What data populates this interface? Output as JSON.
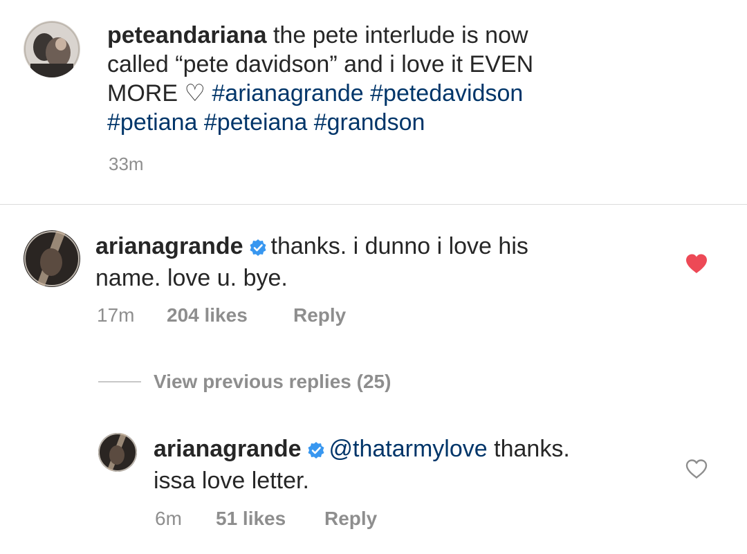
{
  "caption": {
    "username": "peteandariana",
    "text_line1": "the pete interlude is now",
    "text_line2": "called “pete davidson” and i love it EVEN",
    "text_line3_plain": "MORE ♡",
    "hashtags_line3": "#arianagrande #petedavidson",
    "hashtags_line4": "#petiana #peteiana #grandson",
    "time": "33m"
  },
  "comments": [
    {
      "username": "arianagrande",
      "verified": true,
      "text_line1": "thanks. i dunno i love his",
      "text_line2": "name. love u. bye.",
      "time": "17m",
      "likes": "204 likes",
      "reply_label": "Reply",
      "liked": true,
      "like_color": "#ed4956"
    }
  ],
  "view_previous": "View previous replies (25)",
  "replies": [
    {
      "username": "arianagrande",
      "verified": true,
      "mention": "@thatarmylove",
      "text_line1": "thanks.",
      "text_line2": "issa love letter.",
      "time": "6m",
      "likes": "51 likes",
      "reply_label": "Reply",
      "liked": false
    }
  ],
  "colors": {
    "text": "#262626",
    "secondary": "#8e8e8e",
    "link": "#003569",
    "verified": "#3897f0",
    "divider": "#dbdbdb"
  }
}
